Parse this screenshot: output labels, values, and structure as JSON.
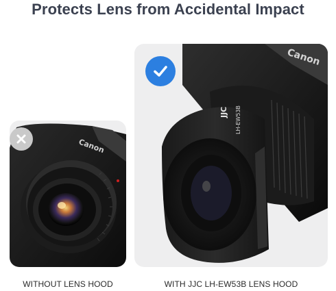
{
  "title": "Protects Lens from Accidental Impact",
  "left_panel": {
    "badge_icon": "x-icon",
    "camera_brand_text": "Canon",
    "caption": "WITHOUT LENS HOOD"
  },
  "right_panel": {
    "badge_icon": "check-icon",
    "camera_brand_text": "Canon",
    "hood_brand_text": "JJC",
    "hood_model_text": "LH-EW53B",
    "caption": "WITH JJC LH-EW53B LENS HOOD"
  },
  "colors": {
    "title": "#3b4150",
    "card_bg": "#eeeeef",
    "check_badge": "#2c7fe0",
    "x_badge": "#c9c9c9"
  }
}
